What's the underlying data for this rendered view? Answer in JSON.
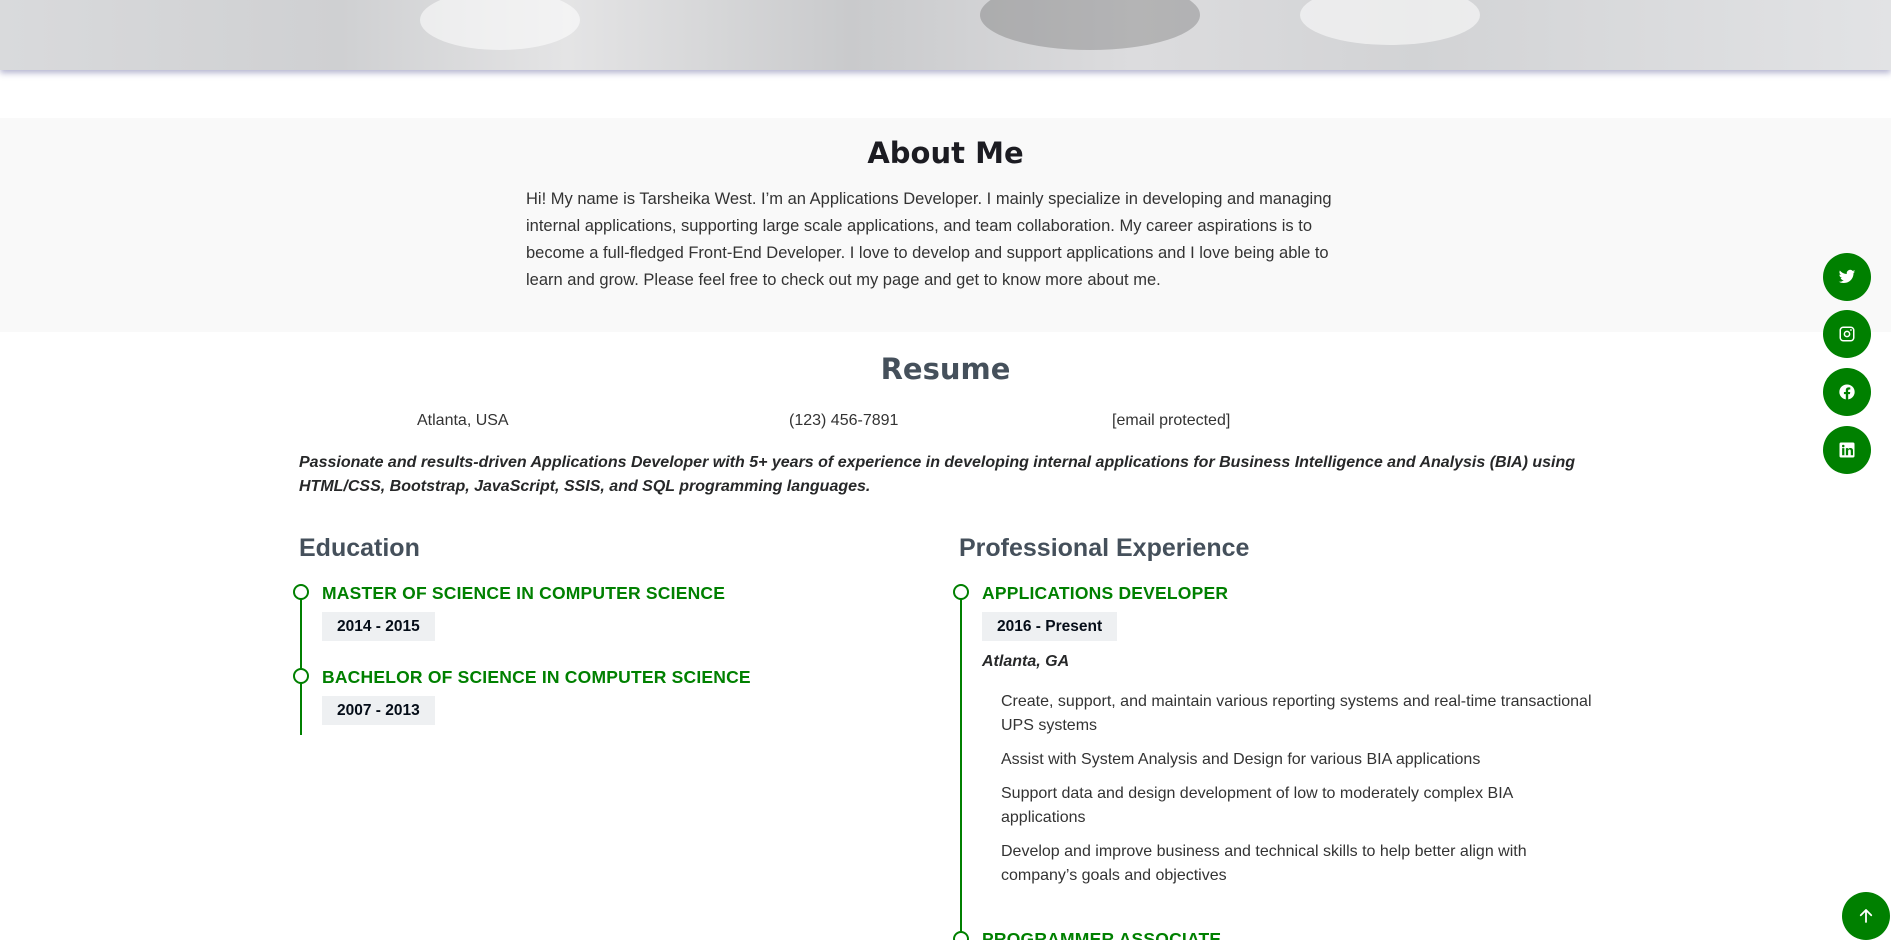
{
  "about": {
    "title": "About Me",
    "text": "Hi! My name is Tarsheika West. I’m an Applications Developer. I mainly specialize in developing and managing internal applications, supporting large scale applications, and team collaboration. My career aspirations is to become a full-fledged Front-End Developer. I love to develop and support applications and I love being able to learn and grow. Please feel free to check out my page and get to know more about me."
  },
  "resume": {
    "title": "Resume",
    "location": "Atlanta, USA",
    "phone": "(123) 456-7891",
    "email": "[email protected]",
    "summary": "Passionate and results-driven Applications Developer with 5+ years of experience in developing internal applications for Business Intelligence and Analysis (BIA) using HTML/CSS, Bootstrap, JavaScript, SSIS, and SQL programming languages."
  },
  "education": {
    "title": "Education",
    "items": [
      {
        "title": "MASTER OF SCIENCE IN COMPUTER SCIENCE",
        "dates": "2014 - 2015"
      },
      {
        "title": "BACHELOR OF SCIENCE IN COMPUTER SCIENCE",
        "dates": "2007 - 2013"
      }
    ]
  },
  "experience": {
    "title": "Professional Experience",
    "items": [
      {
        "title": "APPLICATIONS DEVELOPER",
        "dates": "2016 - Present",
        "location": "Atlanta, GA",
        "duties": [
          "Create, support, and maintain various reporting systems and real-time transactional UPS systems",
          "Assist with System Analysis and Design for various BIA applications",
          "Support data and design development of low to moderately complex BIA applications",
          "Develop and improve business and technical skills to help better align with company’s goals and objectives"
        ]
      },
      {
        "title": "PROGRAMMER ASSOCIATE"
      }
    ]
  },
  "social": [
    "twitter-icon",
    "instagram-icon",
    "facebook-icon",
    "linkedin-icon"
  ],
  "colors": {
    "accent": "#008000",
    "heading": "#45505b",
    "badge": "#eef0f2",
    "section_bg": "#f9f9f9"
  }
}
